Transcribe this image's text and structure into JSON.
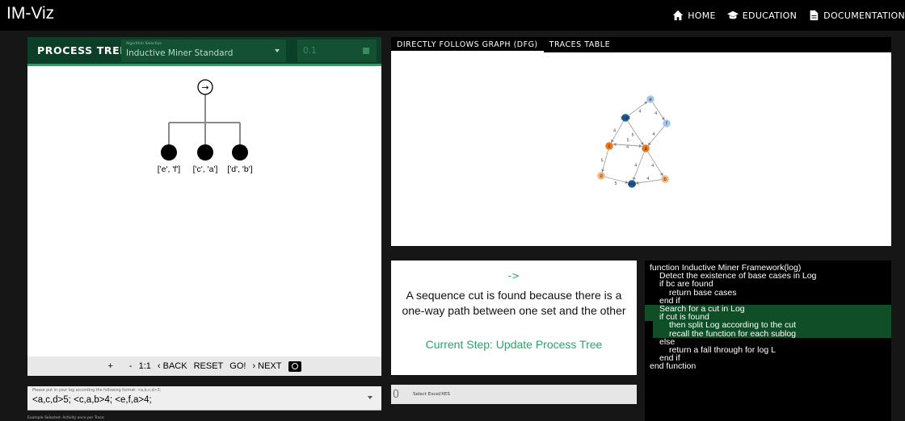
{
  "app": {
    "title": "IM-Viz",
    "nav": [
      {
        "label": "HOME",
        "icon": "home-icon"
      },
      {
        "label": "EDUCATION",
        "icon": "graduation-cap-icon"
      },
      {
        "label": "DOCUMENTATION",
        "icon": "document-icon"
      }
    ]
  },
  "process_tree": {
    "title": "PROCESS TREE",
    "algorithm_label": "Algorithm Selection",
    "algorithm_value": "Inductive Miner Standard",
    "threshold_value": "0.1",
    "root_operator": "→",
    "leaves": [
      "['e', 'f']",
      "['c', 'a']",
      "['d', 'b']"
    ]
  },
  "controls": {
    "zoom_in": "+",
    "zoom_out": "-",
    "reset_zoom": "1:1",
    "back": "‹ BACK",
    "reset": "RESET",
    "go": "GO!",
    "next": "› NEXT",
    "camera_icon": "camera-icon"
  },
  "log": {
    "hint": "Please put in your log according the following format: <a,b,c,d>3;",
    "value": "<a,c,d>5; <c,a,b>4; <e,f,a>4;",
    "status": "Example Selected: Activity once per Trace"
  },
  "dfg": {
    "tabs": [
      "DIRECTLY FOLLOWS GRAPH (DFG)",
      "TRACES TABLE"
    ],
    "active_tab": 0,
    "nodes": [
      {
        "id": "start",
        "label": "start",
        "color": "#1f5f99"
      },
      {
        "id": "e",
        "label": "e",
        "color": "#aac7ea"
      },
      {
        "id": "f",
        "label": "f",
        "color": "#aac7ea"
      },
      {
        "id": "c",
        "label": "c",
        "color": "#ee7a1c"
      },
      {
        "id": "a",
        "label": "a",
        "color": "#ee7a1c"
      },
      {
        "id": "d",
        "label": "d",
        "color": "#f6b87f"
      },
      {
        "id": "b",
        "label": "b",
        "color": "#f6b87f"
      },
      {
        "id": "end",
        "label": "end",
        "color": "#1f5f99"
      }
    ],
    "edges": [
      {
        "from": "start",
        "to": "e",
        "label": "4"
      },
      {
        "from": "e",
        "to": "f",
        "label": "4"
      },
      {
        "from": "start",
        "to": "c",
        "label": "4"
      },
      {
        "from": "start",
        "to": "a",
        "label": "5"
      },
      {
        "from": "f",
        "to": "a",
        "label": "4"
      },
      {
        "from": "c",
        "to": "a",
        "label": "4"
      },
      {
        "from": "a",
        "to": "c",
        "label": "5"
      },
      {
        "from": "c",
        "to": "d",
        "label": "5"
      },
      {
        "from": "a",
        "to": "end",
        "label": "4"
      },
      {
        "from": "a",
        "to": "b",
        "label": "4"
      },
      {
        "from": "d",
        "to": "end",
        "label": "5"
      },
      {
        "from": "b",
        "to": "end",
        "label": "4"
      }
    ]
  },
  "explanation": {
    "cut_symbol": "->",
    "description": "A sequence cut is found because there is a one-way path between one set and the other",
    "current_step": "Current Step: Update Process Tree"
  },
  "file_input": {
    "label": "Select Excel/XES",
    "icon": "paperclip-icon"
  },
  "pseudocode": [
    {
      "text": "function Inductive Miner Framework(log)",
      "indent": 0,
      "hl": ""
    },
    {
      "text": "Detect the existence of base cases in Log",
      "indent": 1,
      "hl": ""
    },
    {
      "text": "if bc are found",
      "indent": 1,
      "hl": ""
    },
    {
      "text": "return base cases",
      "indent": 2,
      "hl": ""
    },
    {
      "text": "end if",
      "indent": 1,
      "hl": ""
    },
    {
      "text": "Search for a cut in Log",
      "indent": 1,
      "hl": "hl"
    },
    {
      "text": "if cut is found",
      "indent": 1,
      "hl": "hl"
    },
    {
      "text": "then split Log according to the cut",
      "indent": 2,
      "hl": "hl2"
    },
    {
      "text": "recall the function for each sublog",
      "indent": 2,
      "hl": "hl2"
    },
    {
      "text": "else",
      "indent": 1,
      "hl": ""
    },
    {
      "text": "return a fall through for log L",
      "indent": 2,
      "hl": ""
    },
    {
      "text": "end if",
      "indent": 1,
      "hl": ""
    },
    {
      "text": "end function",
      "indent": 0,
      "hl": ""
    }
  ]
}
